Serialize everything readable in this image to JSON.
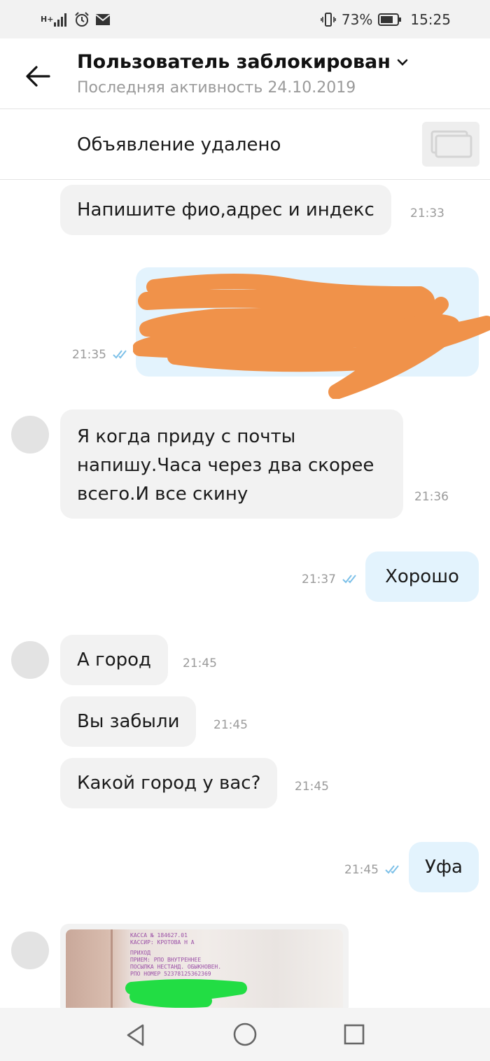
{
  "status": {
    "network": "H+",
    "battery": "73%",
    "time": "15:25"
  },
  "header": {
    "title": "Пользователь заблокирован",
    "subtitle": "Последняя активность 24.10.2019"
  },
  "listing": {
    "text": "Объявление удалено"
  },
  "messages": [
    {
      "dir": "in",
      "text": "Напишите фио,адрес и индекс",
      "time": "21:33"
    },
    {
      "dir": "out",
      "text": "",
      "time": "21:35",
      "censored": true
    },
    {
      "dir": "in",
      "lines": [
        "Я когда приду с почты",
        "напишу.Часа через два скорее",
        "всего.И все скину"
      ],
      "time": "21:36"
    },
    {
      "dir": "out",
      "text": "Хорошо",
      "time": "21:37"
    },
    {
      "dir": "in",
      "text": "А город",
      "time": "21:45"
    },
    {
      "dir": "in",
      "text": "Вы забыли",
      "time": "21:45"
    },
    {
      "dir": "in",
      "text": "Какой город у вас?",
      "time": "21:45"
    },
    {
      "dir": "out",
      "text": "Уфа",
      "time": "21:45"
    }
  ],
  "photo": {
    "receipt_lines": [
      "КАССА № 184627.01",
      "КАССИР: КРОТОВА Н А",
      "ПРИХОД",
      "ПРИЕМ: РПО ВНУТРЕННЕЕ",
      "ПОСЫЛКА НЕСТАНД. ОБЫКНОВЕН.",
      "РПО НОМЕР 52378125362369"
    ]
  },
  "colors": {
    "incoming_bubble": "#f2f2f2",
    "outgoing_bubble": "#e3f3fd",
    "read_checks": "#7cc0e8",
    "scribble_orange": "#f0924a",
    "scribble_green": "#22dd44"
  },
  "icons": {
    "back": "arrow-left-icon",
    "title_chevron": "chevron-down-icon",
    "read_status": "double-check-icon",
    "nav_back": "triangle-back-icon",
    "nav_home": "circle-home-icon",
    "nav_recent": "square-recent-icon"
  }
}
